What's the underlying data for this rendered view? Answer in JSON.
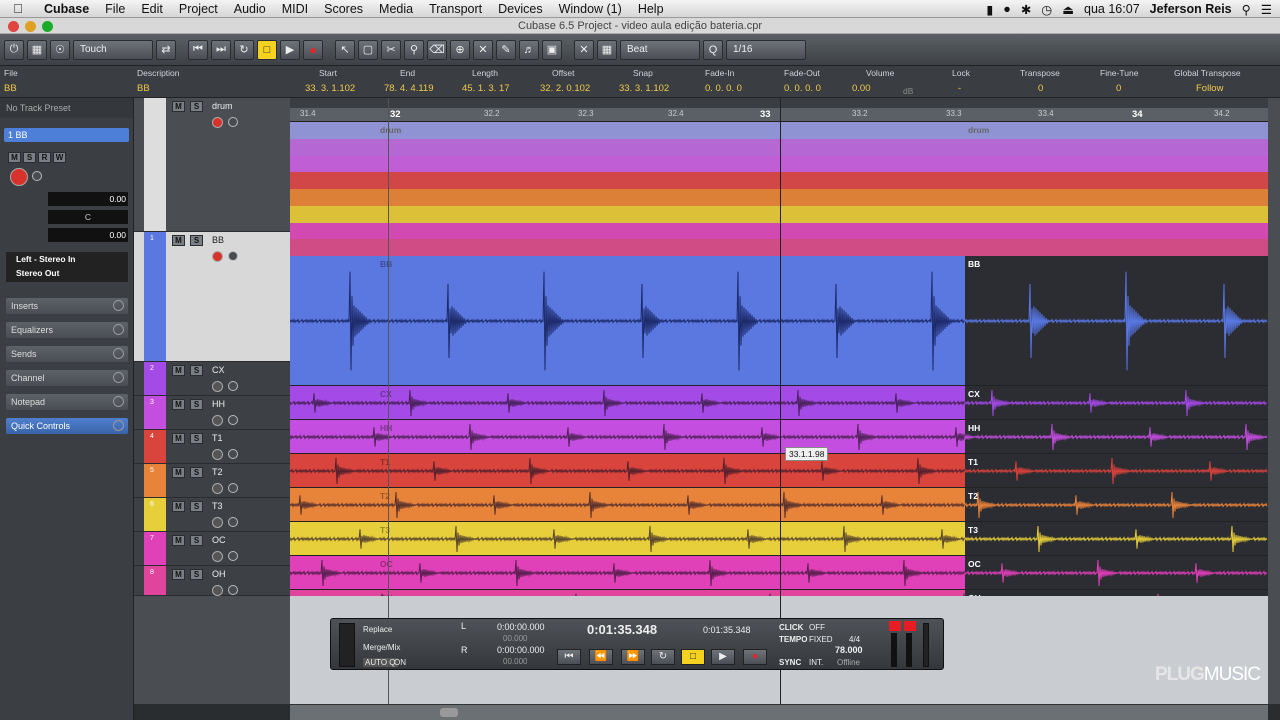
{
  "menubar": {
    "app": "Cubase",
    "items": [
      "File",
      "Edit",
      "Project",
      "Audio",
      "MIDI",
      "Scores",
      "Media",
      "Transport",
      "Devices",
      "Window (1)",
      "Help"
    ],
    "clock": "qua 16:07",
    "user": "Jeferson Reis"
  },
  "window": {
    "title": "Cubase 6.5 Project - video aula edição bateria.cpr"
  },
  "toolbar": {
    "automation_mode": "Touch",
    "quantize_mode": "Beat",
    "quantize_value": "1/16"
  },
  "infoline": {
    "fields": [
      {
        "label": "File",
        "value": "BB"
      },
      {
        "label": "Description",
        "value": "BB"
      },
      {
        "label": "Start",
        "value": "33. 3. 1.102"
      },
      {
        "label": "End",
        "value": "78. 4. 4.119"
      },
      {
        "label": "Length",
        "value": "45. 1. 3. 17"
      },
      {
        "label": "Offset",
        "value": "32. 2. 0.102"
      },
      {
        "label": "Snap",
        "value": "33. 3. 1.102"
      },
      {
        "label": "Fade-In",
        "value": "0. 0. 0. 0"
      },
      {
        "label": "Fade-Out",
        "value": "0. 0. 0. 0"
      },
      {
        "label": "Volume",
        "value": "0.00"
      },
      {
        "label": "Lock",
        "value": "-"
      },
      {
        "label": "Transpose",
        "value": "0"
      },
      {
        "label": "Fine-Tune",
        "value": "0"
      },
      {
        "label": "Global Transpose",
        "value": "Follow"
      }
    ],
    "volume_unit": "dB"
  },
  "inspector": {
    "preset": "No Track Preset",
    "track_name": "1 BB",
    "volume": "0.00",
    "pan": "C",
    "delay": "0.00",
    "input": "Left - Stereo In",
    "output": "Stereo Out",
    "sections": [
      "Inserts",
      "Equalizers",
      "Sends",
      "Channel",
      "Notepad",
      "Quick Controls"
    ]
  },
  "ruler": {
    "labels": [
      "31.4",
      "32",
      "32.2",
      "32.3",
      "32.4",
      "33",
      "33.2",
      "33.3",
      "33.4",
      "34",
      "34.2"
    ]
  },
  "tracks": [
    {
      "num": "",
      "name": "drum",
      "event": "drum"
    },
    {
      "num": "1",
      "name": "BB",
      "event": "BB"
    },
    {
      "num": "2",
      "name": "CX",
      "event": "CX"
    },
    {
      "num": "3",
      "name": "HH",
      "event": "HH"
    },
    {
      "num": "4",
      "name": "T1",
      "event": "T1"
    },
    {
      "num": "5",
      "name": "T2",
      "event": "T2"
    },
    {
      "num": "6",
      "name": "T3",
      "event": "T3"
    },
    {
      "num": "7",
      "name": "OC",
      "event": "OC"
    },
    {
      "num": "8",
      "name": "OH",
      "event": "OH"
    }
  ],
  "colors": {
    "BB": "#5a78e0",
    "CX": "#a44ae6",
    "HH": "#c44ee0",
    "T1": "#d9443c",
    "T2": "#e8843a",
    "T3": "#e6cf3a",
    "OC": "#e040b8",
    "OH": "#e0449c"
  },
  "tooltip": "33.1.1.98",
  "transport": {
    "mode1": "Replace",
    "mode2": "Merge/Mix",
    "auto_q": "AUTO Q",
    "auto_q_state": "ON",
    "locator_left": "0:00:00.000",
    "locator_left_sub": "00.000",
    "locator_right": "0:00:00.000",
    "locator_right_sub": "00.000",
    "primary_time": "0:01:35.348",
    "secondary_time": "0:01:35.348",
    "click": "CLICK",
    "click_state": "OFF",
    "tempo": "TEMPO",
    "tempo_mode": "FIXED",
    "signature": "4/4",
    "tempo_value": "78.000",
    "sync": "SYNC",
    "sync_mode": "INT.",
    "sync_state": "Offline"
  },
  "watermark": {
    "a": "PLUG",
    "b": "MUSIC"
  }
}
